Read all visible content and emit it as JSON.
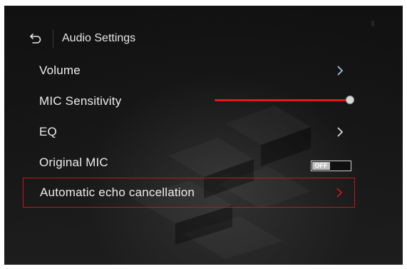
{
  "header": {
    "title": "Audio Settings",
    "back_icon": "back-arrow-icon",
    "status_icon": "bluetooth-icon"
  },
  "settings": [
    {
      "label": "Volume",
      "control": "chevron"
    },
    {
      "label": "MIC Sensitivity",
      "control": "slider",
      "value": 1.0
    },
    {
      "label": "EQ",
      "control": "chevron"
    },
    {
      "label": "Original MIC",
      "control": "toggle",
      "state": "OFF"
    },
    {
      "label": "Automatic echo cancellation",
      "control": "chevron",
      "selected": true
    }
  ],
  "colors": {
    "accent": "#e01a1a",
    "selection_border": "#c4161c",
    "text": "#ececec",
    "chevron": "#9ec2ee"
  }
}
